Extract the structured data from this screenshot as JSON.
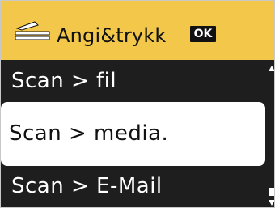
{
  "header": {
    "title": "Angi&trykk",
    "ok_badge": "OK",
    "icon": "scan-icon",
    "background_color": "#f3c84a"
  },
  "menu": {
    "items": [
      {
        "label": "Scan > fil",
        "selected": false
      },
      {
        "label": "Scan > media.",
        "selected": true
      },
      {
        "label": "Scan > E-Mail",
        "selected": false
      }
    ]
  },
  "scrollbar": {
    "icon_up": "arrow-up-icon",
    "icon_down": "arrow-down-icon"
  }
}
